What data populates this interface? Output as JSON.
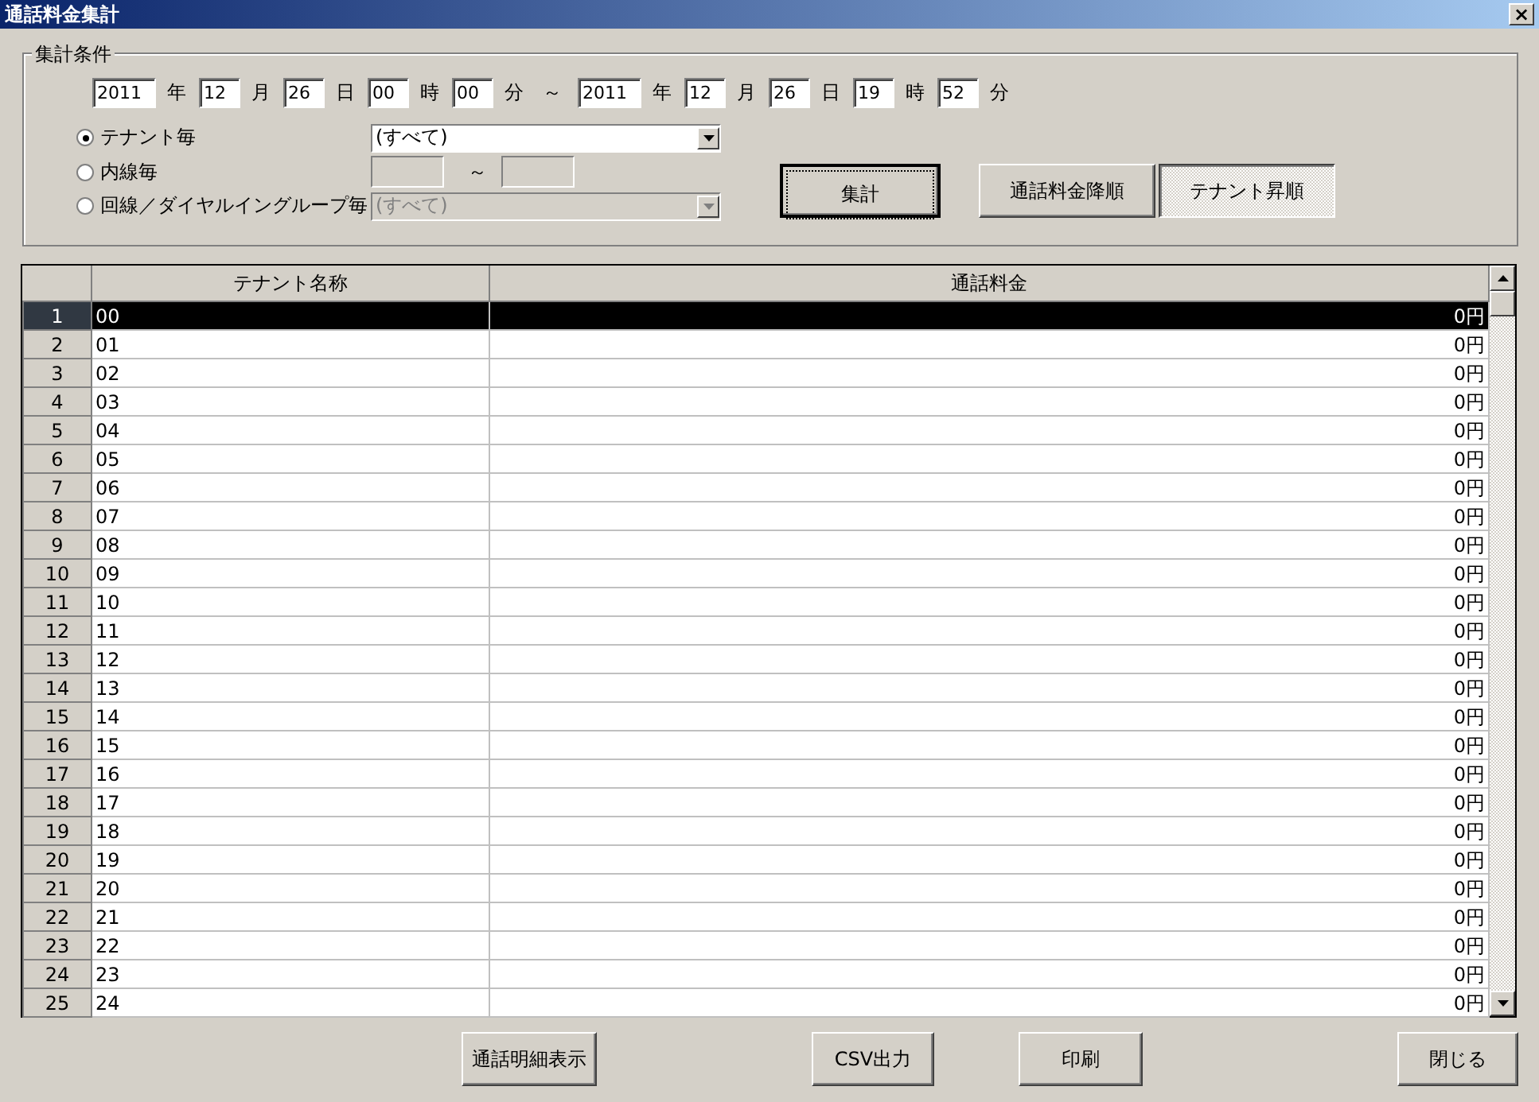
{
  "window": {
    "title": "通話料金集計",
    "close": "×"
  },
  "conditions": {
    "label": "集計条件",
    "from": [
      {
        "value": "2011",
        "unit": "年"
      },
      {
        "value": "12",
        "unit": "月"
      },
      {
        "value": "26",
        "unit": "日"
      },
      {
        "value": "00",
        "unit": "時"
      },
      {
        "value": "00",
        "unit": "分"
      }
    ],
    "range_separator": "～",
    "to": [
      {
        "value": "2011",
        "unit": "年"
      },
      {
        "value": "12",
        "unit": "月"
      },
      {
        "value": "26",
        "unit": "日"
      },
      {
        "value": "19",
        "unit": "時"
      },
      {
        "value": "52",
        "unit": "分"
      }
    ],
    "options": [
      {
        "kind": "combo",
        "label": "テナント毎",
        "selected": true,
        "value": "(すべて)",
        "disabled": false
      },
      {
        "kind": "range",
        "label": "内線毎",
        "selected": false,
        "separator": "～",
        "disabled": true
      },
      {
        "kind": "combo",
        "label": "回線／ダイヤルイングループ毎",
        "selected": false,
        "value": "(すべて)",
        "disabled": true
      }
    ],
    "aggregate_button": {
      "label": "集計",
      "focused": true
    },
    "sort_buttons": [
      {
        "label": "通話料金降順",
        "selected": false
      },
      {
        "label": "テナント昇順",
        "selected": true
      }
    ]
  },
  "table": {
    "columns": [
      "テナント名称",
      "通話料金"
    ],
    "rows": [
      {
        "n": "1",
        "name": "00",
        "fee": "0円",
        "selected": true
      },
      {
        "n": "2",
        "name": "01",
        "fee": "0円",
        "selected": false
      },
      {
        "n": "3",
        "name": "02",
        "fee": "0円",
        "selected": false
      },
      {
        "n": "4",
        "name": "03",
        "fee": "0円",
        "selected": false
      },
      {
        "n": "5",
        "name": "04",
        "fee": "0円",
        "selected": false
      },
      {
        "n": "6",
        "name": "05",
        "fee": "0円",
        "selected": false
      },
      {
        "n": "7",
        "name": "06",
        "fee": "0円",
        "selected": false
      },
      {
        "n": "8",
        "name": "07",
        "fee": "0円",
        "selected": false
      },
      {
        "n": "9",
        "name": "08",
        "fee": "0円",
        "selected": false
      },
      {
        "n": "10",
        "name": "09",
        "fee": "0円",
        "selected": false
      },
      {
        "n": "11",
        "name": "10",
        "fee": "0円",
        "selected": false
      },
      {
        "n": "12",
        "name": "11",
        "fee": "0円",
        "selected": false
      },
      {
        "n": "13",
        "name": "12",
        "fee": "0円",
        "selected": false
      },
      {
        "n": "14",
        "name": "13",
        "fee": "0円",
        "selected": false
      },
      {
        "n": "15",
        "name": "14",
        "fee": "0円",
        "selected": false
      },
      {
        "n": "16",
        "name": "15",
        "fee": "0円",
        "selected": false
      },
      {
        "n": "17",
        "name": "16",
        "fee": "0円",
        "selected": false
      },
      {
        "n": "18",
        "name": "17",
        "fee": "0円",
        "selected": false
      },
      {
        "n": "19",
        "name": "18",
        "fee": "0円",
        "selected": false
      },
      {
        "n": "20",
        "name": "19",
        "fee": "0円",
        "selected": false
      },
      {
        "n": "21",
        "name": "20",
        "fee": "0円",
        "selected": false
      },
      {
        "n": "22",
        "name": "21",
        "fee": "0円",
        "selected": false
      },
      {
        "n": "23",
        "name": "22",
        "fee": "0円",
        "selected": false
      },
      {
        "n": "24",
        "name": "23",
        "fee": "0円",
        "selected": false
      },
      {
        "n": "25",
        "name": "24",
        "fee": "0円",
        "selected": false
      }
    ]
  },
  "buttons": [
    "通話明細表示",
    "CSV出力",
    "印刷",
    "閉じる"
  ]
}
